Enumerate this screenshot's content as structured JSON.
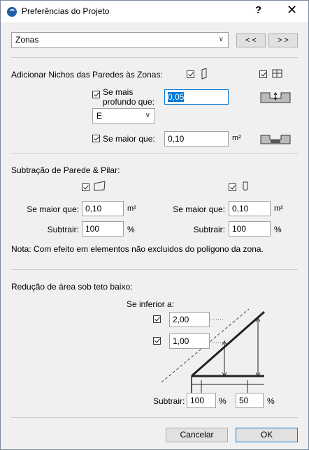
{
  "window": {
    "title": "Preferências do Projeto",
    "help_label": "?",
    "close_label": "✕"
  },
  "header": {
    "category_value": "Zonas",
    "prev_label": "< <",
    "next_label": "> >"
  },
  "niches": {
    "heading": "Adicionar Nichos das Paredes às Zonas:",
    "depth_label_line1": "Se mais",
    "depth_label_line2": "profundo que:",
    "depth_value": "0,05",
    "direction_value": "E",
    "size_label": "Se maior que:",
    "size_value": "0,10",
    "size_unit": "m²"
  },
  "subtraction": {
    "heading": "Subtração de Parede & Pilar:",
    "wall": {
      "size_label": "Se maior que:",
      "size_value": "0,10",
      "size_unit": "m²",
      "subtract_label": "Subtrair:",
      "subtract_value": "100",
      "subtract_unit": "%"
    },
    "column": {
      "size_label": "Se maior que:",
      "size_value": "0,10",
      "size_unit": "m²",
      "subtract_label": "Subtrair:",
      "subtract_value": "100",
      "subtract_unit": "%"
    },
    "note": "Nota: Com efeito em elementos não excluidos do polígono da zona."
  },
  "reduction": {
    "heading": "Redução de área sob teto baixo:",
    "if_lower_label": "Se inferior a:",
    "height1_value": "2,00",
    "height2_value": "1,00",
    "subtract_label": "Subtrair:",
    "subtract1_value": "100",
    "subtract1_unit": "%",
    "subtract2_value": "50",
    "subtract2_unit": "%"
  },
  "footer": {
    "cancel_label": "Cancelar",
    "ok_label": "OK"
  }
}
